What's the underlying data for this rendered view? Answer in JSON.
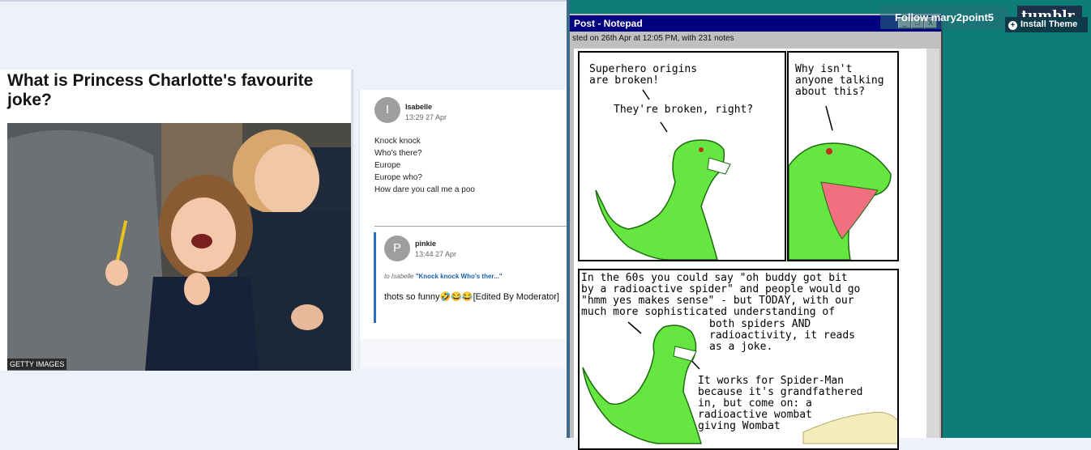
{
  "article": {
    "headline": "What is Princess Charlotte's favourite joke?",
    "photo_credit": "GETTY IMAGES"
  },
  "comments": [
    {
      "initial": "I",
      "author": "Isabelle",
      "time": "13:29 27 Apr",
      "lines": [
        "Knock knock",
        "Who's there?",
        "Europe",
        "Europe who?",
        "How dare you call me a poo"
      ]
    },
    {
      "initial": "P",
      "author": "pinkie",
      "time": "13:44 27 Apr",
      "reply_to_prefix": "to Isabelle",
      "reply_to_quote": "\"Knock knock Who's ther...\"",
      "text": "thots so funny🤣😂😂[Edited By Moderator]"
    }
  ],
  "notepad": {
    "title": "Post - Notepad",
    "meta": "sted on 26th Apr at 12:05 PM, with 231 notes",
    "buttons": [
      "_",
      "□",
      "X"
    ]
  },
  "comic": {
    "panel1_line1": "Superhero origins\nare broken!",
    "panel1_line2": "They're broken, right?",
    "panel2_line1": "Why isn't\nanyone talking\nabout this?",
    "panel3_line1": "In the 60s you could say \"oh buddy got bit\nby a radioactive spider\" and people would go\n\"hmm yes makes sense\" - but TODAY, with our\nmuch more sophisticated understanding of",
    "panel3_line2": "both spiders AND\nradioactivity, it reads\nas a joke.",
    "panel3_line3": "It works for Spider-Man\nbecause it's grandfathered\nin, but come on: a\nradioactive wombat\ngiving Wombat"
  },
  "tumblr": {
    "follow_label": "Follow mary2point5",
    "logo": "tumblr.",
    "install_label": "Install Theme",
    "install_icon": "plus-circle-icon"
  },
  "colors": {
    "teal_background": "#0c7d78",
    "notepad_titlebar": "#000080",
    "dinosaur_green": "#66e640",
    "reply_accent": "#2a6ebb"
  }
}
